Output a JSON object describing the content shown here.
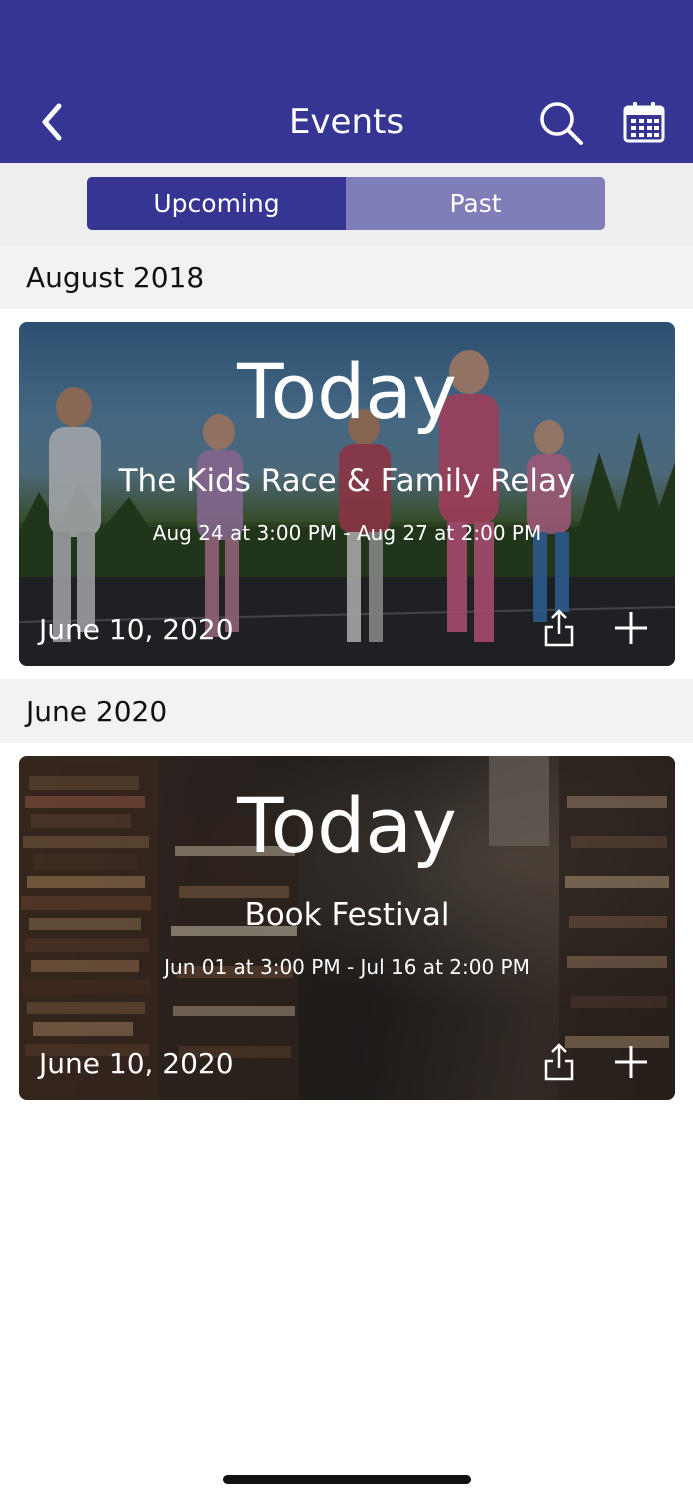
{
  "header": {
    "title": "Events",
    "background_color": "#363593",
    "icons": [
      "chevron-left-icon",
      "search-icon",
      "calendar-icon"
    ]
  },
  "tabs": {
    "upcoming": "Upcoming",
    "past": "Past",
    "active_color": "#363593",
    "inactive_color": "#7f7eb8"
  },
  "sections": [
    {
      "heading": "August 2018",
      "event": {
        "big_label": "Today",
        "title": "The Kids Race & Family Relay",
        "range": "Aug 24 at 3:00 PM - Aug 27 at 2:00 PM",
        "date": "June 10, 2020"
      }
    },
    {
      "heading": "June 2020",
      "event": {
        "big_label": "Today",
        "title": "Book Festival",
        "range": "Jun 01 at 3:00 PM - Jul 16 at 2:00 PM",
        "date": "June 10, 2020"
      }
    }
  ]
}
